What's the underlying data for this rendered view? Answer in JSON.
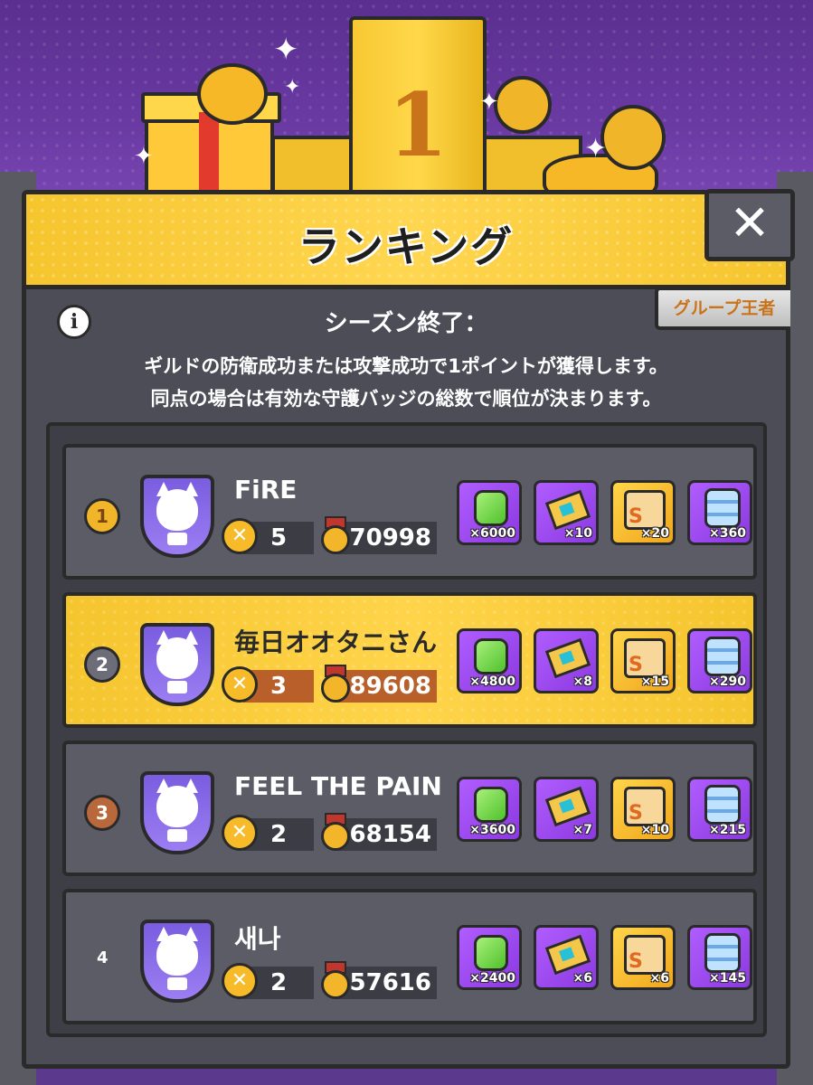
{
  "header": {
    "title": "ランキング",
    "close_label": "✕",
    "season_label": "シーズン終了：",
    "group_tab_label": "グループ王者",
    "info_label": "i",
    "description_line1": "ギルドの防衛成功または攻撃成功で1ポイントが獲得します。",
    "description_line2": "同点の場合は有効な守護バッジの総数で順位が決まります。"
  },
  "colors": {
    "accent_yellow": "#f6c52e",
    "panel_gray": "#5b5c66",
    "background_purple": "#5a2f8f"
  },
  "rows": [
    {
      "rank": "1",
      "rank_style": "gold",
      "name": "FiRE",
      "points": "5",
      "badges": "70998",
      "highlighted": false,
      "rewards": [
        "×6000",
        "×10",
        "×20",
        "×360"
      ]
    },
    {
      "rank": "2",
      "rank_style": "silver",
      "name": "毎日オオタニさん",
      "points": "3",
      "badges": "89608",
      "highlighted": true,
      "rewards": [
        "×4800",
        "×8",
        "×15",
        "×290"
      ]
    },
    {
      "rank": "3",
      "rank_style": "bronze",
      "name": "FEEL THE PAIN",
      "points": "2",
      "badges": "68154",
      "highlighted": false,
      "rewards": [
        "×3600",
        "×7",
        "×10",
        "×215"
      ]
    },
    {
      "rank": "4",
      "rank_style": "plain",
      "name": "새나",
      "points": "2",
      "badges": "57616",
      "highlighted": false,
      "rewards": [
        "×2400",
        "×6",
        "×6",
        "×145"
      ]
    }
  ],
  "reward_icons": [
    "gem-icon",
    "ticket-icon",
    "puzzle-piece-icon",
    "cube-icon"
  ],
  "decor": {
    "podium_number": "1"
  }
}
